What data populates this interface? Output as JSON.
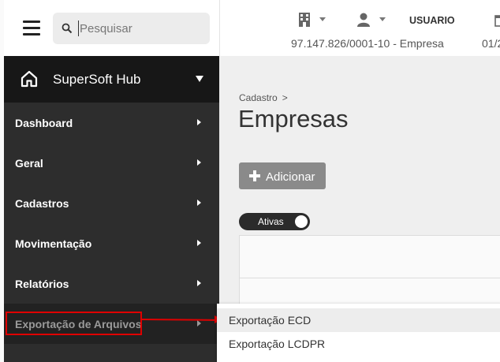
{
  "header": {
    "search_placeholder": "Pesquisar",
    "user_label": "USUARIO",
    "company": "97.147.826/0001-10 - Empresa",
    "date_partial": "01/2"
  },
  "sidebar": {
    "brand": "SuperSoft Hub",
    "items": [
      {
        "label": "Dashboard"
      },
      {
        "label": "Geral"
      },
      {
        "label": "Cadastros"
      },
      {
        "label": "Movimentação"
      },
      {
        "label": "Relatórios"
      },
      {
        "label": "Exportação de Arquivos"
      }
    ]
  },
  "main": {
    "breadcrumb": "Cadastro",
    "breadcrumb_sep": ">",
    "title": "Empresas",
    "add_label": "Adicionar",
    "toggle_label": "Ativas"
  },
  "submenu": {
    "items": [
      {
        "label": "Exportação ECD"
      },
      {
        "label": "Exportação LCDPR"
      }
    ]
  },
  "icons": {
    "menu": "hamburger-menu-icon",
    "search": "search-icon",
    "building": "building-icon",
    "user": "user-icon",
    "calendar": "calendar-icon",
    "home": "home-icon"
  },
  "colors": {
    "sidebar_bg": "#2d2d2d",
    "brand_bg": "#171717",
    "annotation": "#e00000",
    "button_bg": "#8a8a8a"
  }
}
